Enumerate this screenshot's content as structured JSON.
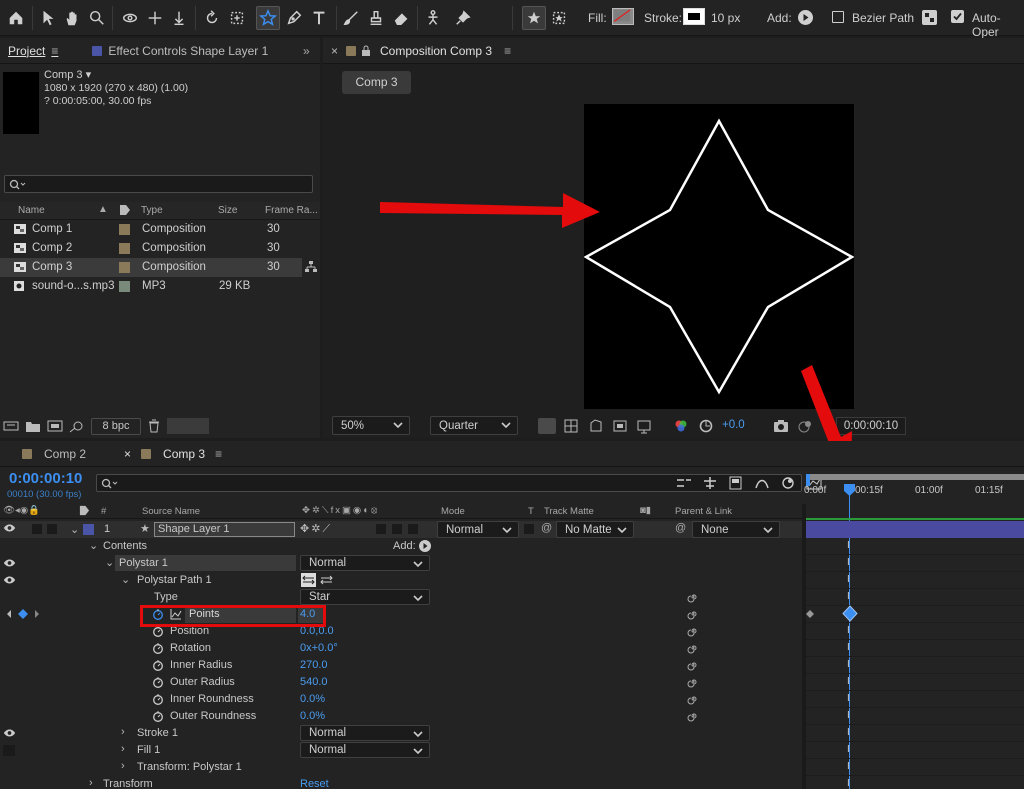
{
  "toolbar": {
    "fill_label": "Fill:",
    "stroke_label": "Stroke:",
    "stroke_width": "10 px",
    "add_label": "Add:",
    "bezier_label": "Bezier Path",
    "autoopen_label": "Auto-Oper",
    "accent": "#3c8ef0"
  },
  "project": {
    "tab_label": "Project",
    "effect_tab": "Effect Controls Shape Layer 1",
    "comp_name": "Comp 3",
    "comp_dims": "1080 x 1920  (270 x 480) (1.00)",
    "comp_duration": "? 0:00:05:00, 30.00 fps",
    "columns": {
      "name": "Name",
      "type": "Type",
      "size": "Size",
      "fps": "Frame Ra..."
    },
    "items": [
      {
        "name": "Comp 1",
        "type": "Composition",
        "size": "",
        "fps": "30",
        "swatch": "#8a7a5a"
      },
      {
        "name": "Comp 2",
        "type": "Composition",
        "size": "",
        "fps": "30",
        "swatch": "#8a7a5a"
      },
      {
        "name": "Comp 3",
        "type": "Composition",
        "size": "",
        "fps": "30",
        "swatch": "#8a7a5a"
      },
      {
        "name": "sound-o...s.mp3",
        "type": "MP3",
        "size": "29 KB",
        "fps": "",
        "swatch": "#7a8a7a"
      }
    ],
    "bpc": "8 bpc"
  },
  "comp_viewer": {
    "tab_label": "Composition Comp 3",
    "comp_button": "Comp 3",
    "zoom": "50%",
    "resolution": "Quarter",
    "exposure": "+0.0",
    "timecode": "0:00:00:10"
  },
  "timeline": {
    "tabs": [
      "Comp 2",
      "Comp 3"
    ],
    "current_time": "0:00:00:10",
    "frame_info": "00010 (30.00 fps)",
    "headers": {
      "hash": "#",
      "source_name": "Source Name",
      "mode": "Mode",
      "t": "T",
      "track_matte": "Track Matte",
      "parent": "Parent & Link"
    },
    "ruler": [
      "0:00f",
      "00:15f",
      "01:00f",
      "01:15f"
    ],
    "layer": {
      "index": "1",
      "name": "Shape Layer 1",
      "mode": "Normal",
      "matte": "No Matte",
      "parent": "None"
    },
    "contents_label": "Contents",
    "add_label": "Add:",
    "polystar": {
      "label": "Polystar 1",
      "mode": "Normal"
    },
    "polystar_path": "Polystar Path 1",
    "type": {
      "label": "Type",
      "value": "Star"
    },
    "props": [
      {
        "label": "Points",
        "value": "4.0"
      },
      {
        "label": "Position",
        "value": "0.0,0.0"
      },
      {
        "label": "Rotation",
        "value": "0x+0.0°"
      },
      {
        "label": "Inner Radius",
        "value": "270.0"
      },
      {
        "label": "Outer Radius",
        "value": "540.0"
      },
      {
        "label": "Inner Roundness",
        "value": "0.0%"
      },
      {
        "label": "Outer Roundness",
        "value": "0.0%"
      }
    ],
    "stroke": {
      "label": "Stroke 1",
      "mode": "Normal"
    },
    "fill": {
      "label": "Fill 1",
      "mode": "Normal"
    },
    "transform_polystar": "Transform: Polystar 1",
    "transform": {
      "label": "Transform",
      "reset": "Reset"
    }
  }
}
